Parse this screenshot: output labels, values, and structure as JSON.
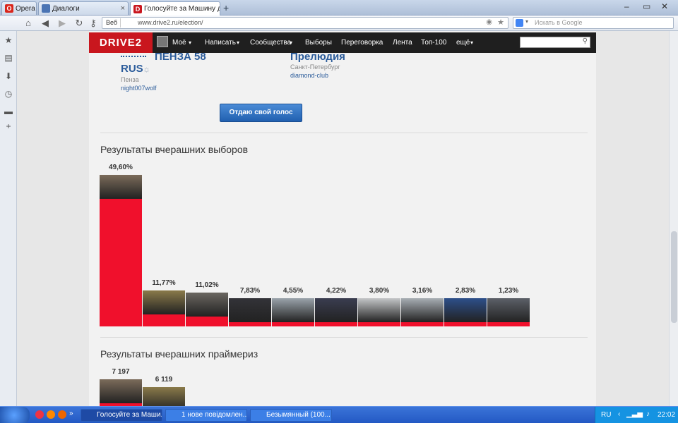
{
  "browser": {
    "tabs": [
      {
        "label": "Opera",
        "icon": "opera-icon"
      },
      {
        "label": "Диалоги",
        "icon": "page-icon"
      },
      {
        "label": "Голосуйте за Машину дня",
        "icon": "drive2-icon"
      }
    ],
    "new_tab_label": "+",
    "web_label": "Веб",
    "url": "www.drive2.ru/election/",
    "search_placeholder": "Искать в Google"
  },
  "site": {
    "logo": "DRIVE2",
    "nav": [
      "Моё",
      "Написать",
      "Сообщества",
      "Выборы",
      "Переговорка",
      "Лента",
      "Топ-100",
      "ещё"
    ]
  },
  "candidates": [
    {
      "name_line1": "ПЕНЗА 58",
      "name_line2": "RUS",
      "city": "Пенза",
      "user": "night007wolf"
    },
    {
      "name_line1": "Прелюдия",
      "city": "Санкт-Петербург",
      "user": "diamond-club"
    }
  ],
  "vote_button": "Отдаю свой голос",
  "results": {
    "title": "Результаты вчерашних выборов",
    "bars": [
      {
        "label": "49,60%",
        "value": 49.6
      },
      {
        "label": "11,77%",
        "value": 11.77
      },
      {
        "label": "11,02%",
        "value": 11.02
      },
      {
        "label": "7,83%",
        "value": 7.83
      },
      {
        "label": "4,55%",
        "value": 4.55
      },
      {
        "label": "4,22%",
        "value": 4.22
      },
      {
        "label": "3,80%",
        "value": 3.8
      },
      {
        "label": "3,16%",
        "value": 3.16
      },
      {
        "label": "2,83%",
        "value": 2.83
      },
      {
        "label": "1,23%",
        "value": 1.23
      }
    ]
  },
  "primaries": {
    "title": "Результаты вчерашних праймериз",
    "bars": [
      {
        "label": "7 197",
        "value": 7197
      },
      {
        "label": "6 119",
        "value": 6119
      }
    ]
  },
  "taskbar": {
    "tasks": [
      "Голосуйте за Маши...",
      "1 нове повідомлен...",
      "Безымянный (100..."
    ],
    "lang": "RU",
    "time": "22:02"
  },
  "colors": {
    "bar": "#f0102c",
    "logo": "#c9161e",
    "link": "#2a5b9a"
  }
}
